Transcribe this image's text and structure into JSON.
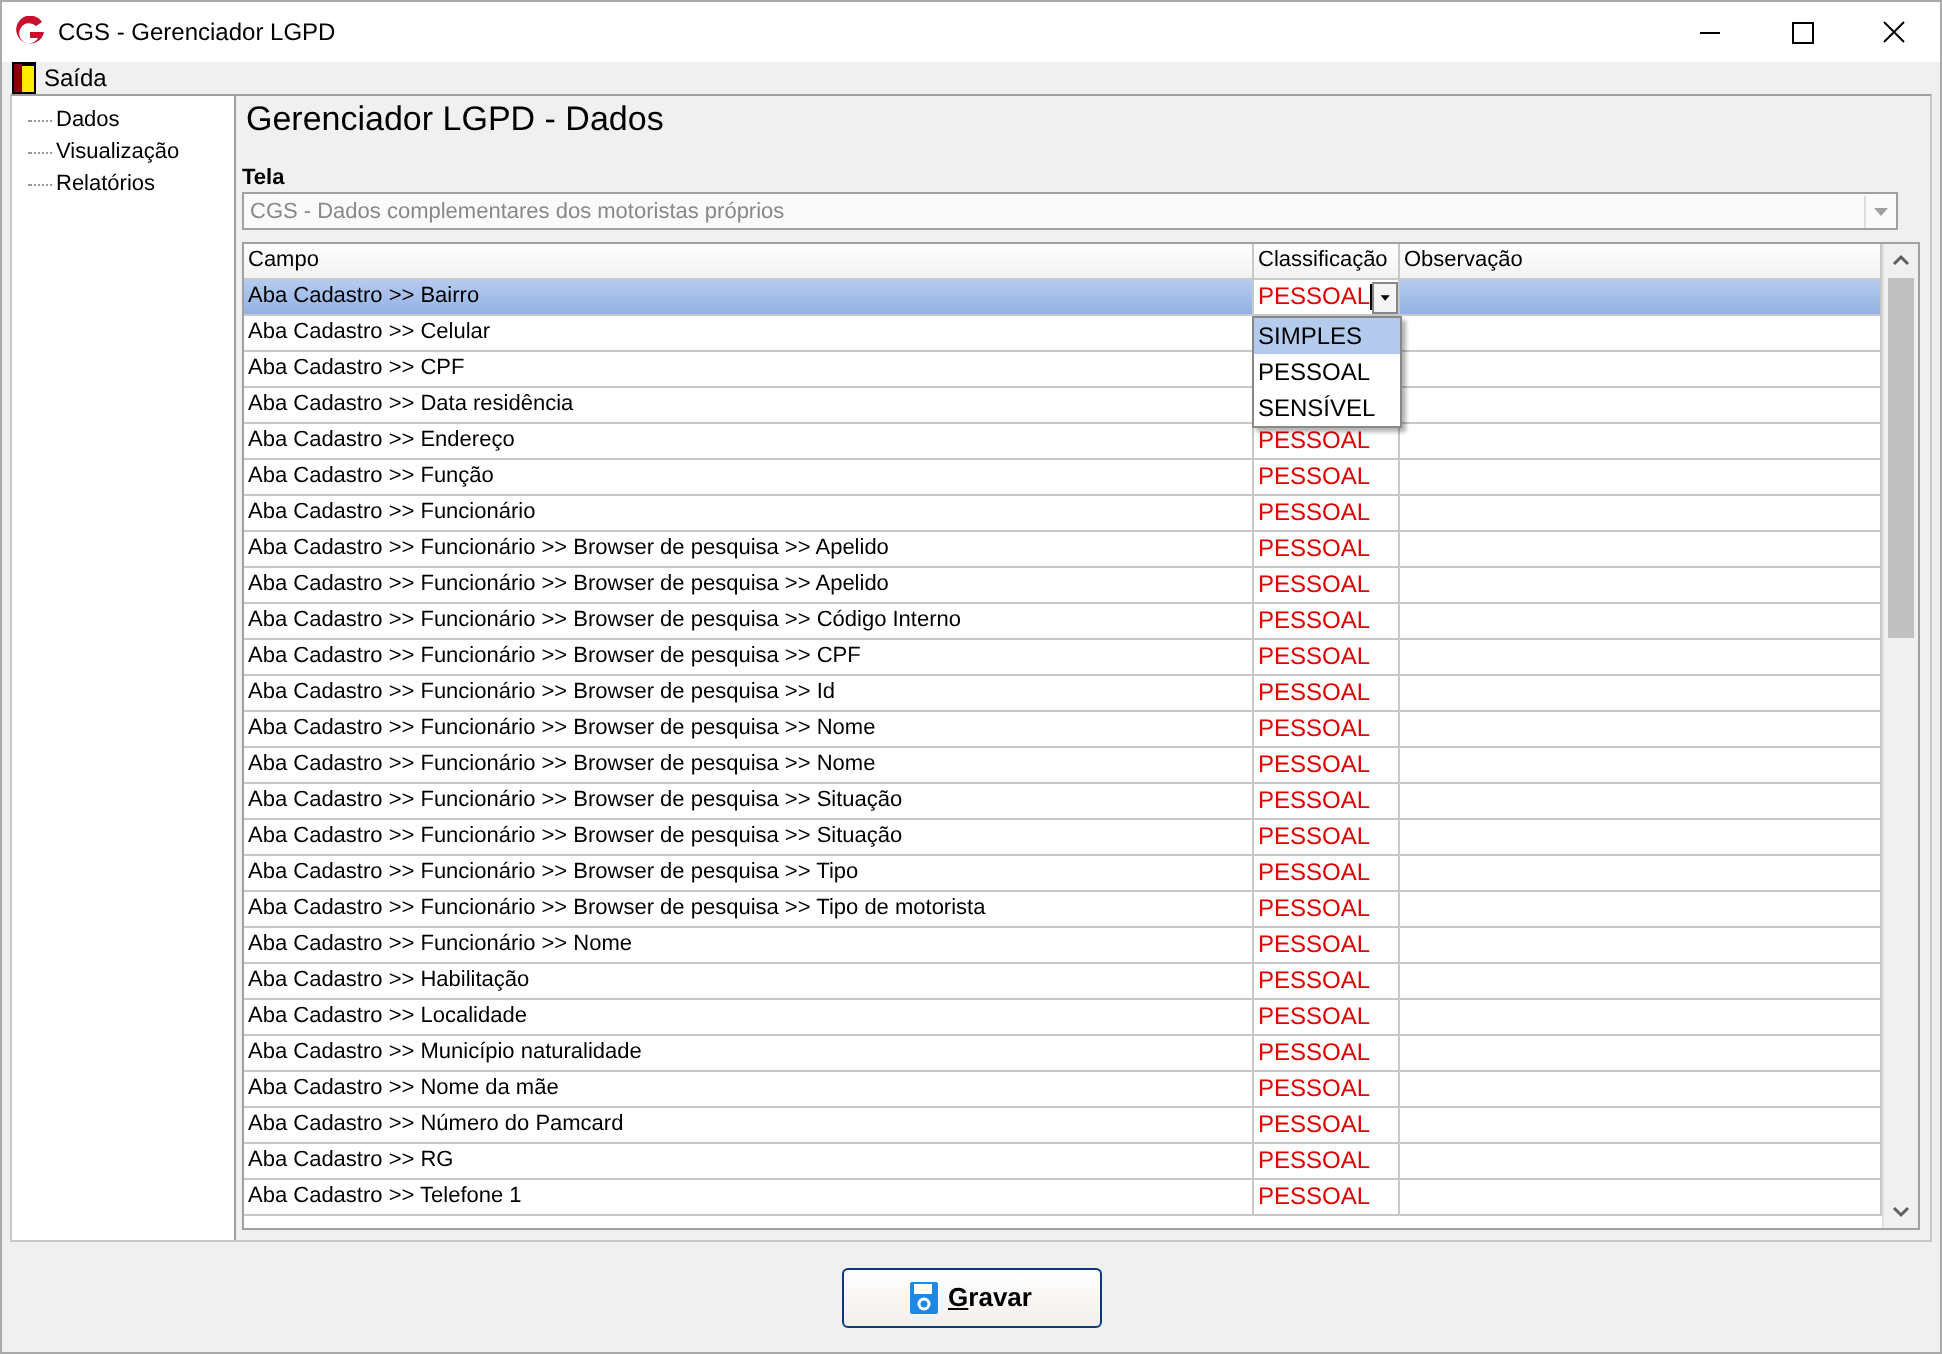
{
  "window": {
    "title": "CGS - Gerenciador LGPD"
  },
  "menu": [
    {
      "label": "Saída"
    }
  ],
  "sidebar": {
    "items": [
      {
        "label": "Dados"
      },
      {
        "label": "Visualização"
      },
      {
        "label": "Relatórios"
      }
    ]
  },
  "heading": "Gerenciador LGPD - Dados",
  "screen_field": {
    "label": "Tela",
    "value": "CGS - Dados complementares dos motoristas próprios",
    "disabled": true
  },
  "table": {
    "columns": [
      "Campo",
      "Classificação",
      "Observação"
    ],
    "rows": [
      {
        "campo": "Aba Cadastro >> Bairro",
        "classificacao": "PESSOAL",
        "selected": true,
        "editing": true
      },
      {
        "campo": "Aba Cadastro >> Celular",
        "selected": false
      },
      {
        "campo": "Aba Cadastro >> CPF",
        "selected": false
      },
      {
        "campo": "Aba Cadastro >> Data residência",
        "selected": false
      },
      {
        "campo": "Aba Cadastro >> Endereço",
        "classificacao": "PESSOAL",
        "selected": false
      },
      {
        "campo": "Aba Cadastro >> Função",
        "classificacao": "PESSOAL",
        "selected": false
      },
      {
        "campo": "Aba Cadastro >> Funcionário",
        "classificacao": "PESSOAL",
        "selected": false
      },
      {
        "campo": "Aba Cadastro >> Funcionário >> Browser de pesquisa >> Apelido",
        "classificacao": "PESSOAL",
        "selected": false
      },
      {
        "campo": "Aba Cadastro >> Funcionário >> Browser de pesquisa >> Apelido",
        "classificacao": "PESSOAL",
        "selected": false
      },
      {
        "campo": "Aba Cadastro >> Funcionário >> Browser de pesquisa >> Código Interno",
        "classificacao": "PESSOAL",
        "selected": false
      },
      {
        "campo": "Aba Cadastro >> Funcionário >> Browser de pesquisa >> CPF",
        "classificacao": "PESSOAL",
        "selected": false
      },
      {
        "campo": "Aba Cadastro >> Funcionário >> Browser de pesquisa >> Id",
        "classificacao": "PESSOAL",
        "selected": false
      },
      {
        "campo": "Aba Cadastro >> Funcionário >> Browser de pesquisa >> Nome",
        "classificacao": "PESSOAL",
        "selected": false
      },
      {
        "campo": "Aba Cadastro >> Funcionário >> Browser de pesquisa >> Nome",
        "classificacao": "PESSOAL",
        "selected": false
      },
      {
        "campo": "Aba Cadastro >> Funcionário >> Browser de pesquisa >> Situação",
        "classificacao": "PESSOAL",
        "selected": false
      },
      {
        "campo": "Aba Cadastro >> Funcionário >> Browser de pesquisa >> Situação",
        "classificacao": "PESSOAL",
        "selected": false
      },
      {
        "campo": "Aba Cadastro >> Funcionário >> Browser de pesquisa >> Tipo",
        "classificacao": "PESSOAL",
        "selected": false
      },
      {
        "campo": "Aba Cadastro >> Funcionário >> Browser de pesquisa >> Tipo de motorista",
        "classificacao": "PESSOAL",
        "selected": false
      },
      {
        "campo": "Aba Cadastro >> Funcionário >> Nome",
        "classificacao": "PESSOAL",
        "selected": false
      },
      {
        "campo": "Aba Cadastro >> Habilitação",
        "classificacao": "PESSOAL",
        "selected": false
      },
      {
        "campo": "Aba Cadastro >> Localidade",
        "classificacao": "PESSOAL",
        "selected": false
      },
      {
        "campo": "Aba Cadastro >> Município naturalidade",
        "classificacao": "PESSOAL",
        "selected": false
      },
      {
        "campo": "Aba Cadastro >> Nome da mãe",
        "classificacao": "PESSOAL",
        "selected": false
      },
      {
        "campo": "Aba Cadastro >> Número do Pamcard",
        "classificacao": "PESSOAL",
        "selected": false
      },
      {
        "campo": "Aba Cadastro >> RG",
        "classificacao": "PESSOAL",
        "selected": false
      },
      {
        "campo": "Aba Cadastro >> Telefone 1",
        "classificacao": "PESSOAL",
        "selected": false
      }
    ],
    "dropdown": {
      "options": [
        {
          "label": "SIMPLES",
          "selected": true
        },
        {
          "label": "PESSOAL",
          "selected": false
        },
        {
          "label": "SENSÍVEL",
          "selected": false
        }
      ]
    }
  },
  "buttons": [
    {
      "label": "Gravar"
    }
  ]
}
